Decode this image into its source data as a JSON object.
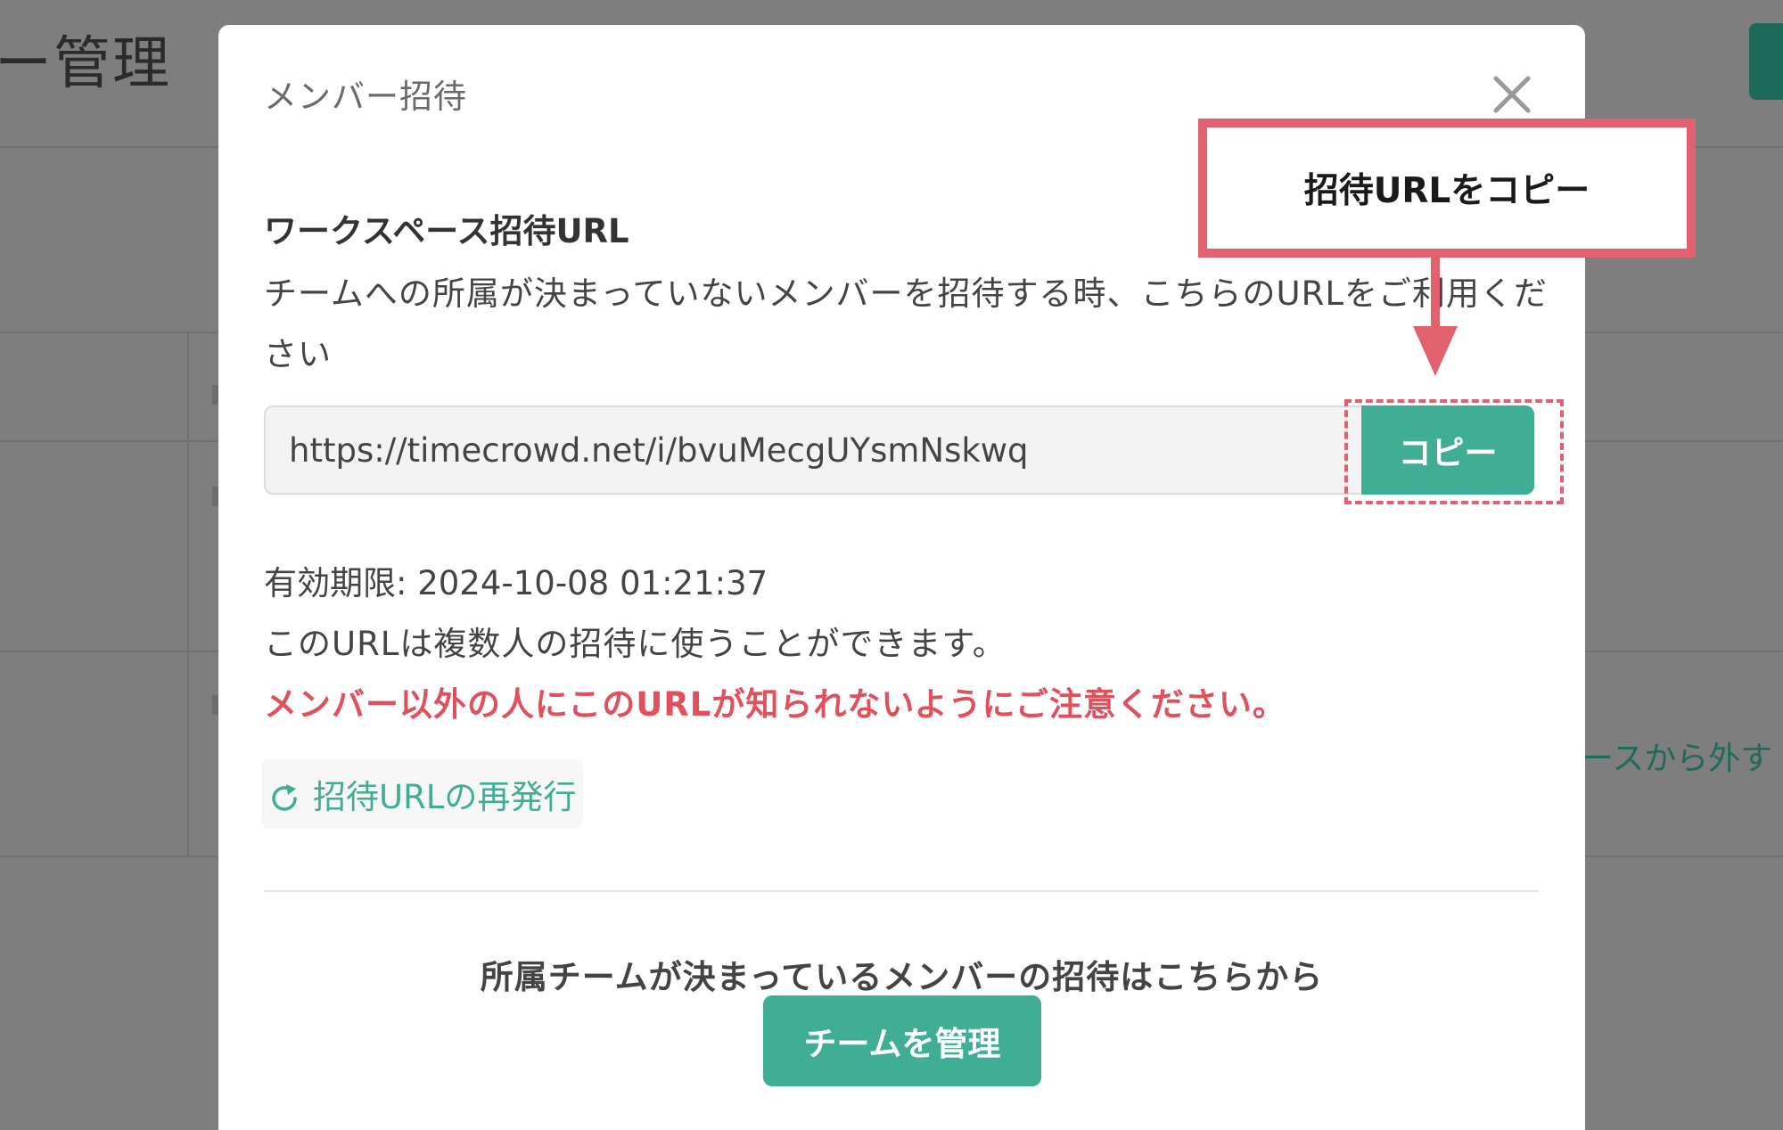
{
  "background": {
    "page_title_fragment": "ー管理",
    "remove_link_fragment": "ースから外す"
  },
  "modal": {
    "title": "メンバー招待",
    "close_icon": "close-icon",
    "workspace_url": {
      "heading": "ワークスペース招待URL",
      "description": "チームへの所属が決まっていないメンバーを招待する時、こちらのURLをご利用ください",
      "url_value": "https://timecrowd.net/i/bvuMecgUYsmNskwq",
      "copy_button_label": "コピー",
      "expiry": "有効期限: 2024-10-08 01:21:37",
      "multi_use_note": "このURLは複数人の招待に使うことができます。",
      "warning": "メンバー以外の人にこのURLが知られないようにご注意ください。",
      "reissue_label": "招待URLの再発行",
      "reissue_icon": "refresh-icon"
    },
    "team_invite": {
      "text": "所属チームが決まっているメンバーの招待はこちらから",
      "manage_button_label": "チームを管理"
    }
  },
  "annotation": {
    "callout_text": "招待URLをコピー"
  },
  "colors": {
    "accent": "#3fae95",
    "warning": "#e0505d",
    "annotation": "#e2616f",
    "overlay": "#7e7e7e"
  }
}
